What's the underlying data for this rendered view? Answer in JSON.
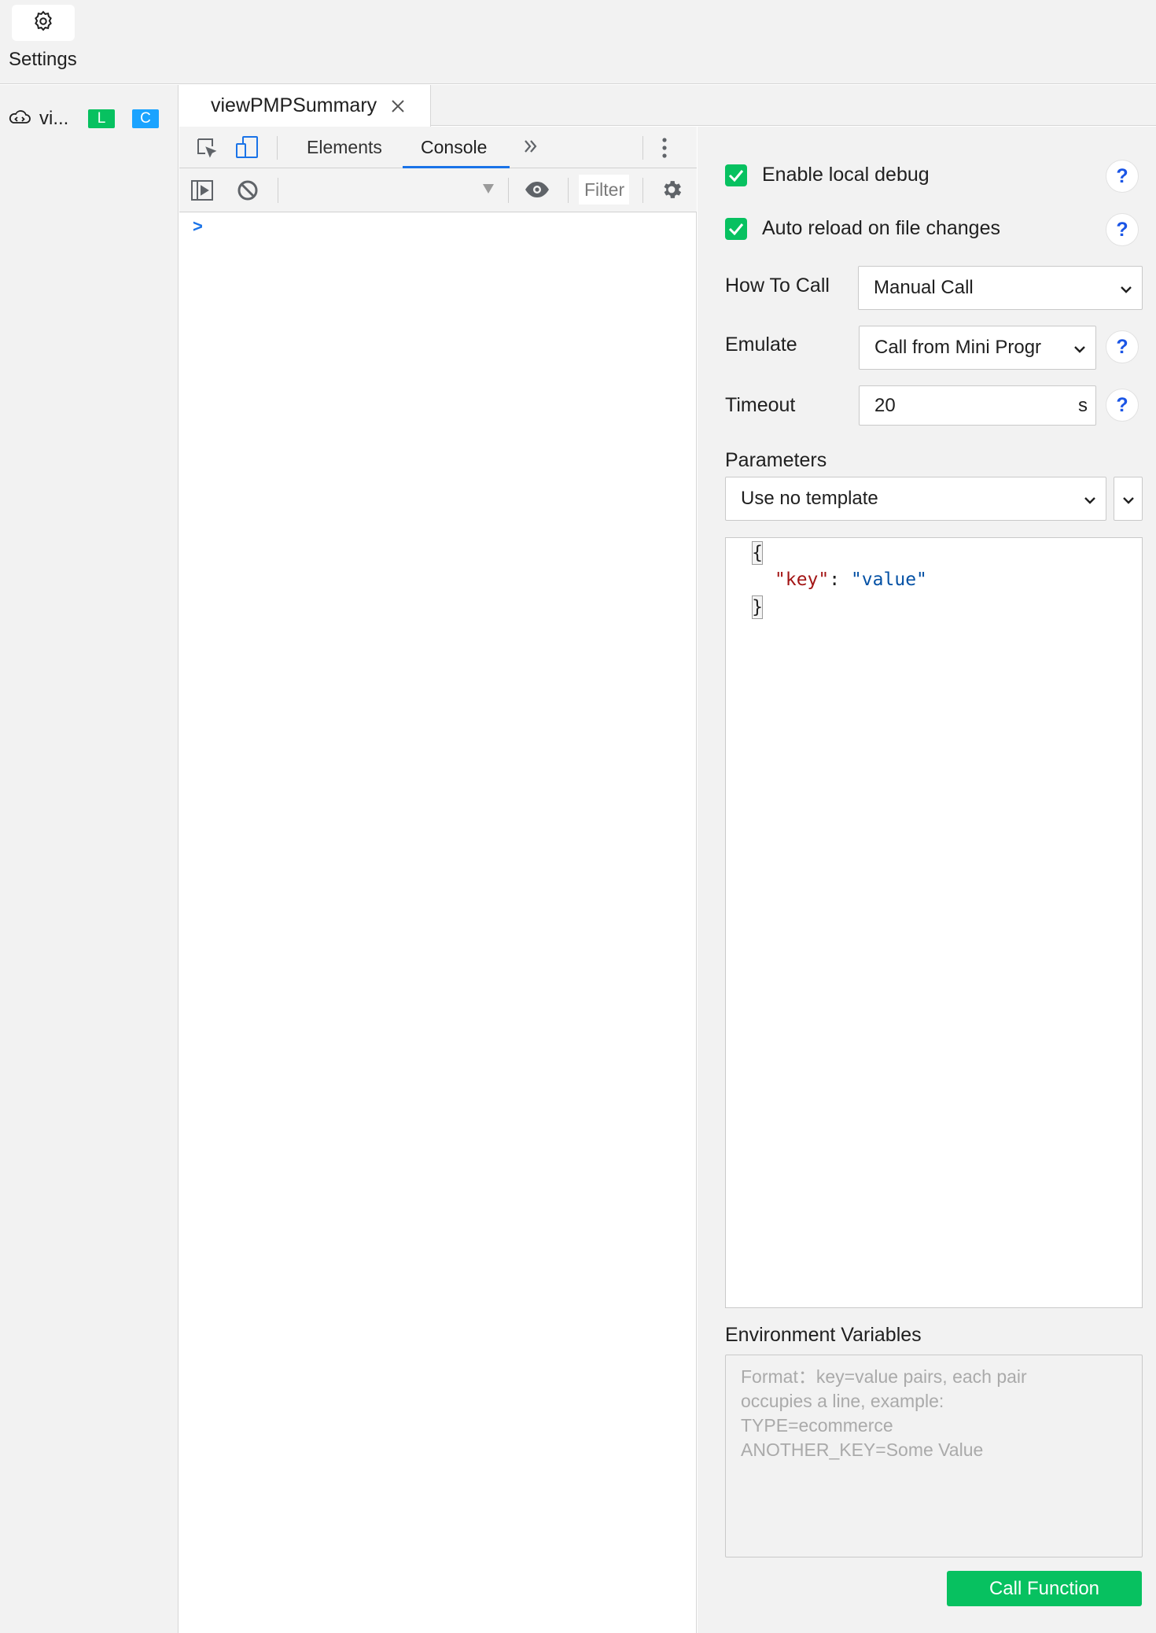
{
  "topbar": {
    "settings_label": "Settings",
    "settings_icon": "gear-icon"
  },
  "sidebar": {
    "project_icon": "cloud-function-icon",
    "project_name": "vi...",
    "badge_local": "L",
    "badge_cloud": "C"
  },
  "tabs": [
    {
      "title": "viewPMPSummary",
      "close_icon": "close-icon"
    }
  ],
  "devtools": {
    "tabs": [
      "Elements",
      "Console"
    ],
    "active_tab": "Console",
    "more_tabs_label": "»",
    "filter_placeholder": "Filter",
    "prompt_symbol": ">"
  },
  "panel": {
    "enable_local_debug": {
      "label": "Enable local debug",
      "checked": true
    },
    "auto_reload": {
      "label": "Auto reload on file changes",
      "checked": true
    },
    "how_to_call": {
      "label": "How To Call",
      "value": "Manual Call"
    },
    "emulate": {
      "label": "Emulate",
      "value": "Call from Mini Progr"
    },
    "timeout": {
      "label": "Timeout",
      "value": "20",
      "unit": "s"
    },
    "parameters": {
      "label": "Parameters",
      "template_value": "Use no template",
      "code": {
        "open_brace": "{",
        "key": "\"key\"",
        "colon": ": ",
        "value": "\"value\"",
        "close_brace": "}"
      }
    },
    "env_vars": {
      "label": "Environment Variables",
      "placeholder": "Format：key=value pairs, each pair\noccupies a line, example:\nTYPE=ecommerce\nANOTHER_KEY=Some Value"
    },
    "help_symbol": "?",
    "call_button": "Call Function"
  },
  "colors": {
    "accent_green": "#07c160",
    "badge_blue": "#1aa3ff",
    "help_blue": "#1a55e6",
    "devtools_active": "#1a73e8"
  }
}
